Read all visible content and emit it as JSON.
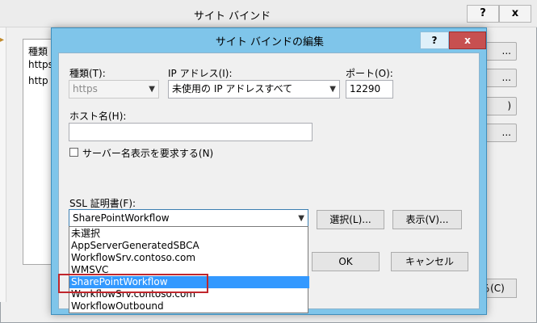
{
  "outer": {
    "title": "サイト バインド",
    "help": "?",
    "close": "x",
    "list": [
      "種類",
      "https",
      "http"
    ],
    "buttons": [
      "...",
      "...",
      ")",
      "..."
    ],
    "close_button": "閉じる(C)"
  },
  "dialog": {
    "title": "サイト バインドの編集",
    "help": "?",
    "close": "x",
    "type_label": "種類(T):",
    "type_value": "https",
    "ip_label": "IP アドレス(I):",
    "ip_value": "未使用の IP アドレスすべて",
    "port_label": "ポート(O):",
    "port_value": "12290",
    "host_label": "ホスト名(H):",
    "host_value": "",
    "sni_label": "サーバー名表示を要求する(N)",
    "sni_checked": false,
    "ssl_label": "SSL 証明書(F):",
    "ssl_value": "SharePointWorkflow",
    "select_button": "選択(L)...",
    "view_button": "表示(V)...",
    "ok_button": "OK",
    "cancel_button": "キャンセル"
  },
  "dropdown": {
    "options": [
      "未選択",
      "AppServerGeneratedSBCA",
      "WorkflowSrv.contoso.com",
      "WMSVC",
      "SharePointWorkflow",
      "WorkflowSrv.contoso.com",
      "WorkflowOutbound"
    ],
    "selected_index": 4
  },
  "colors": {
    "dialog_frame": "#7fc5ea",
    "selection": "#3399ff",
    "highlight_box": "#c0262c",
    "close_red": "#c75050"
  }
}
